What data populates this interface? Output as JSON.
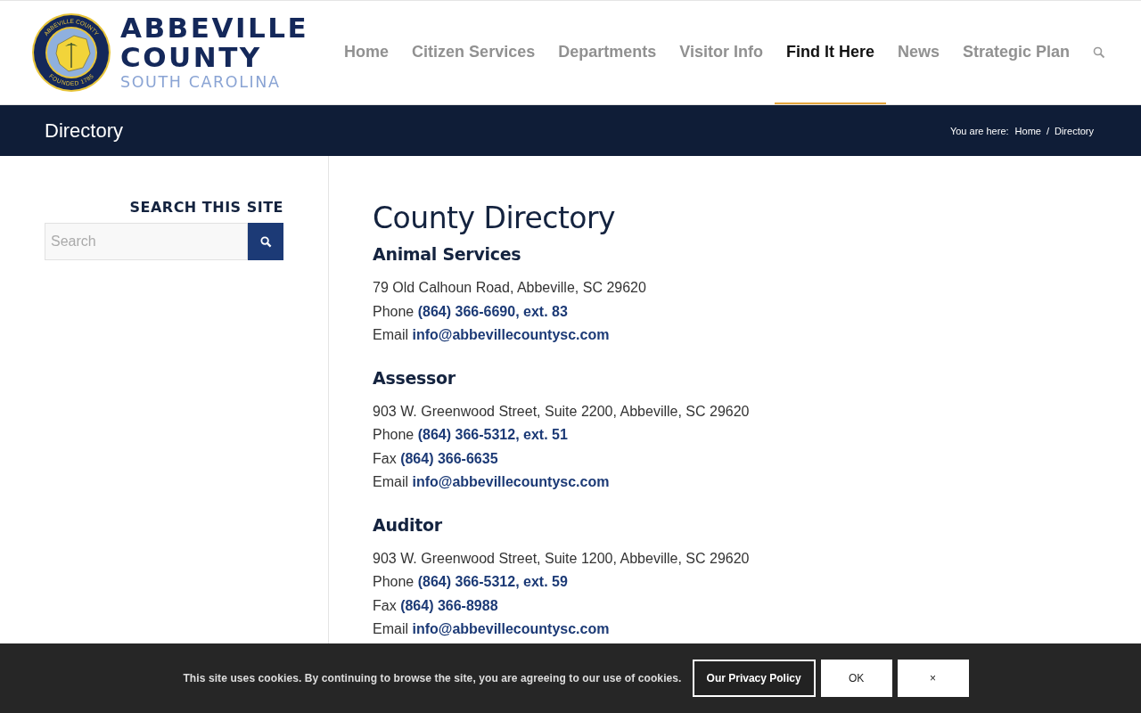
{
  "logo": {
    "seal_top": "ABBEVILLE COUNTY",
    "seal_bottom": "FOUNDED 1785",
    "name_line_1": "ABBEVILLE",
    "name_line_2": "COUNTY",
    "name_line_3": "SOUTH CAROLINA"
  },
  "nav": [
    {
      "label": "Home",
      "selected": false
    },
    {
      "label": "Citizen Services",
      "selected": false
    },
    {
      "label": "Departments",
      "selected": false
    },
    {
      "label": "Visitor Info",
      "selected": false
    },
    {
      "label": "Find It Here",
      "selected": true
    },
    {
      "label": "News",
      "selected": false
    },
    {
      "label": "Strategic Plan",
      "selected": false
    }
  ],
  "title_bar": {
    "title": "Directory",
    "breadcrumb_label": "You are here:",
    "breadcrumb": [
      "Home",
      "Directory"
    ],
    "separator": "/"
  },
  "sidebar": {
    "heading": "SEARCH THIS SITE",
    "search": {
      "placeholder": "Search"
    }
  },
  "content": {
    "title": "County Directory",
    "sections": [
      {
        "name": "Animal Services",
        "lines": [
          {
            "kind": "text",
            "text": "79 Old Calhoun Road, Abbeville, SC 29620"
          },
          {
            "kind": "link",
            "label": "Phone",
            "value": "(864) 366-6690, ext. 83"
          },
          {
            "kind": "link",
            "label": "Email",
            "value": "info@abbevillecountysc.com"
          }
        ]
      },
      {
        "name": "Assessor",
        "lines": [
          {
            "kind": "text",
            "text": "903 W. Greenwood Street, Suite 2200, Abbeville, SC 29620"
          },
          {
            "kind": "link",
            "label": "Phone",
            "value": "(864) 366-5312, ext. 51"
          },
          {
            "kind": "link",
            "label": "Fax",
            "value": "(864) 366-6635"
          },
          {
            "kind": "link",
            "label": "Email",
            "value": "info@abbevillecountysc.com"
          }
        ]
      },
      {
        "name": "Auditor",
        "lines": [
          {
            "kind": "text",
            "text": "903 W. Greenwood Street, Suite 1200, Abbeville, SC 29620"
          },
          {
            "kind": "link",
            "label": "Phone",
            "value": "(864) 366-5312, ext. 59"
          },
          {
            "kind": "link",
            "label": "Fax",
            "value": "(864) 366-8988"
          },
          {
            "kind": "link",
            "label": "Email",
            "value": "info@abbevillecountysc.com"
          }
        ]
      }
    ]
  },
  "cookie_bar": {
    "message": "This site uses cookies. By continuing to browse the site, you are agreeing to our use of cookies.",
    "buttons": [
      {
        "kind": "outline",
        "label": "Our Privacy Policy"
      },
      {
        "kind": "solid",
        "label": "OK"
      },
      {
        "kind": "solid",
        "label": "×"
      }
    ]
  }
}
